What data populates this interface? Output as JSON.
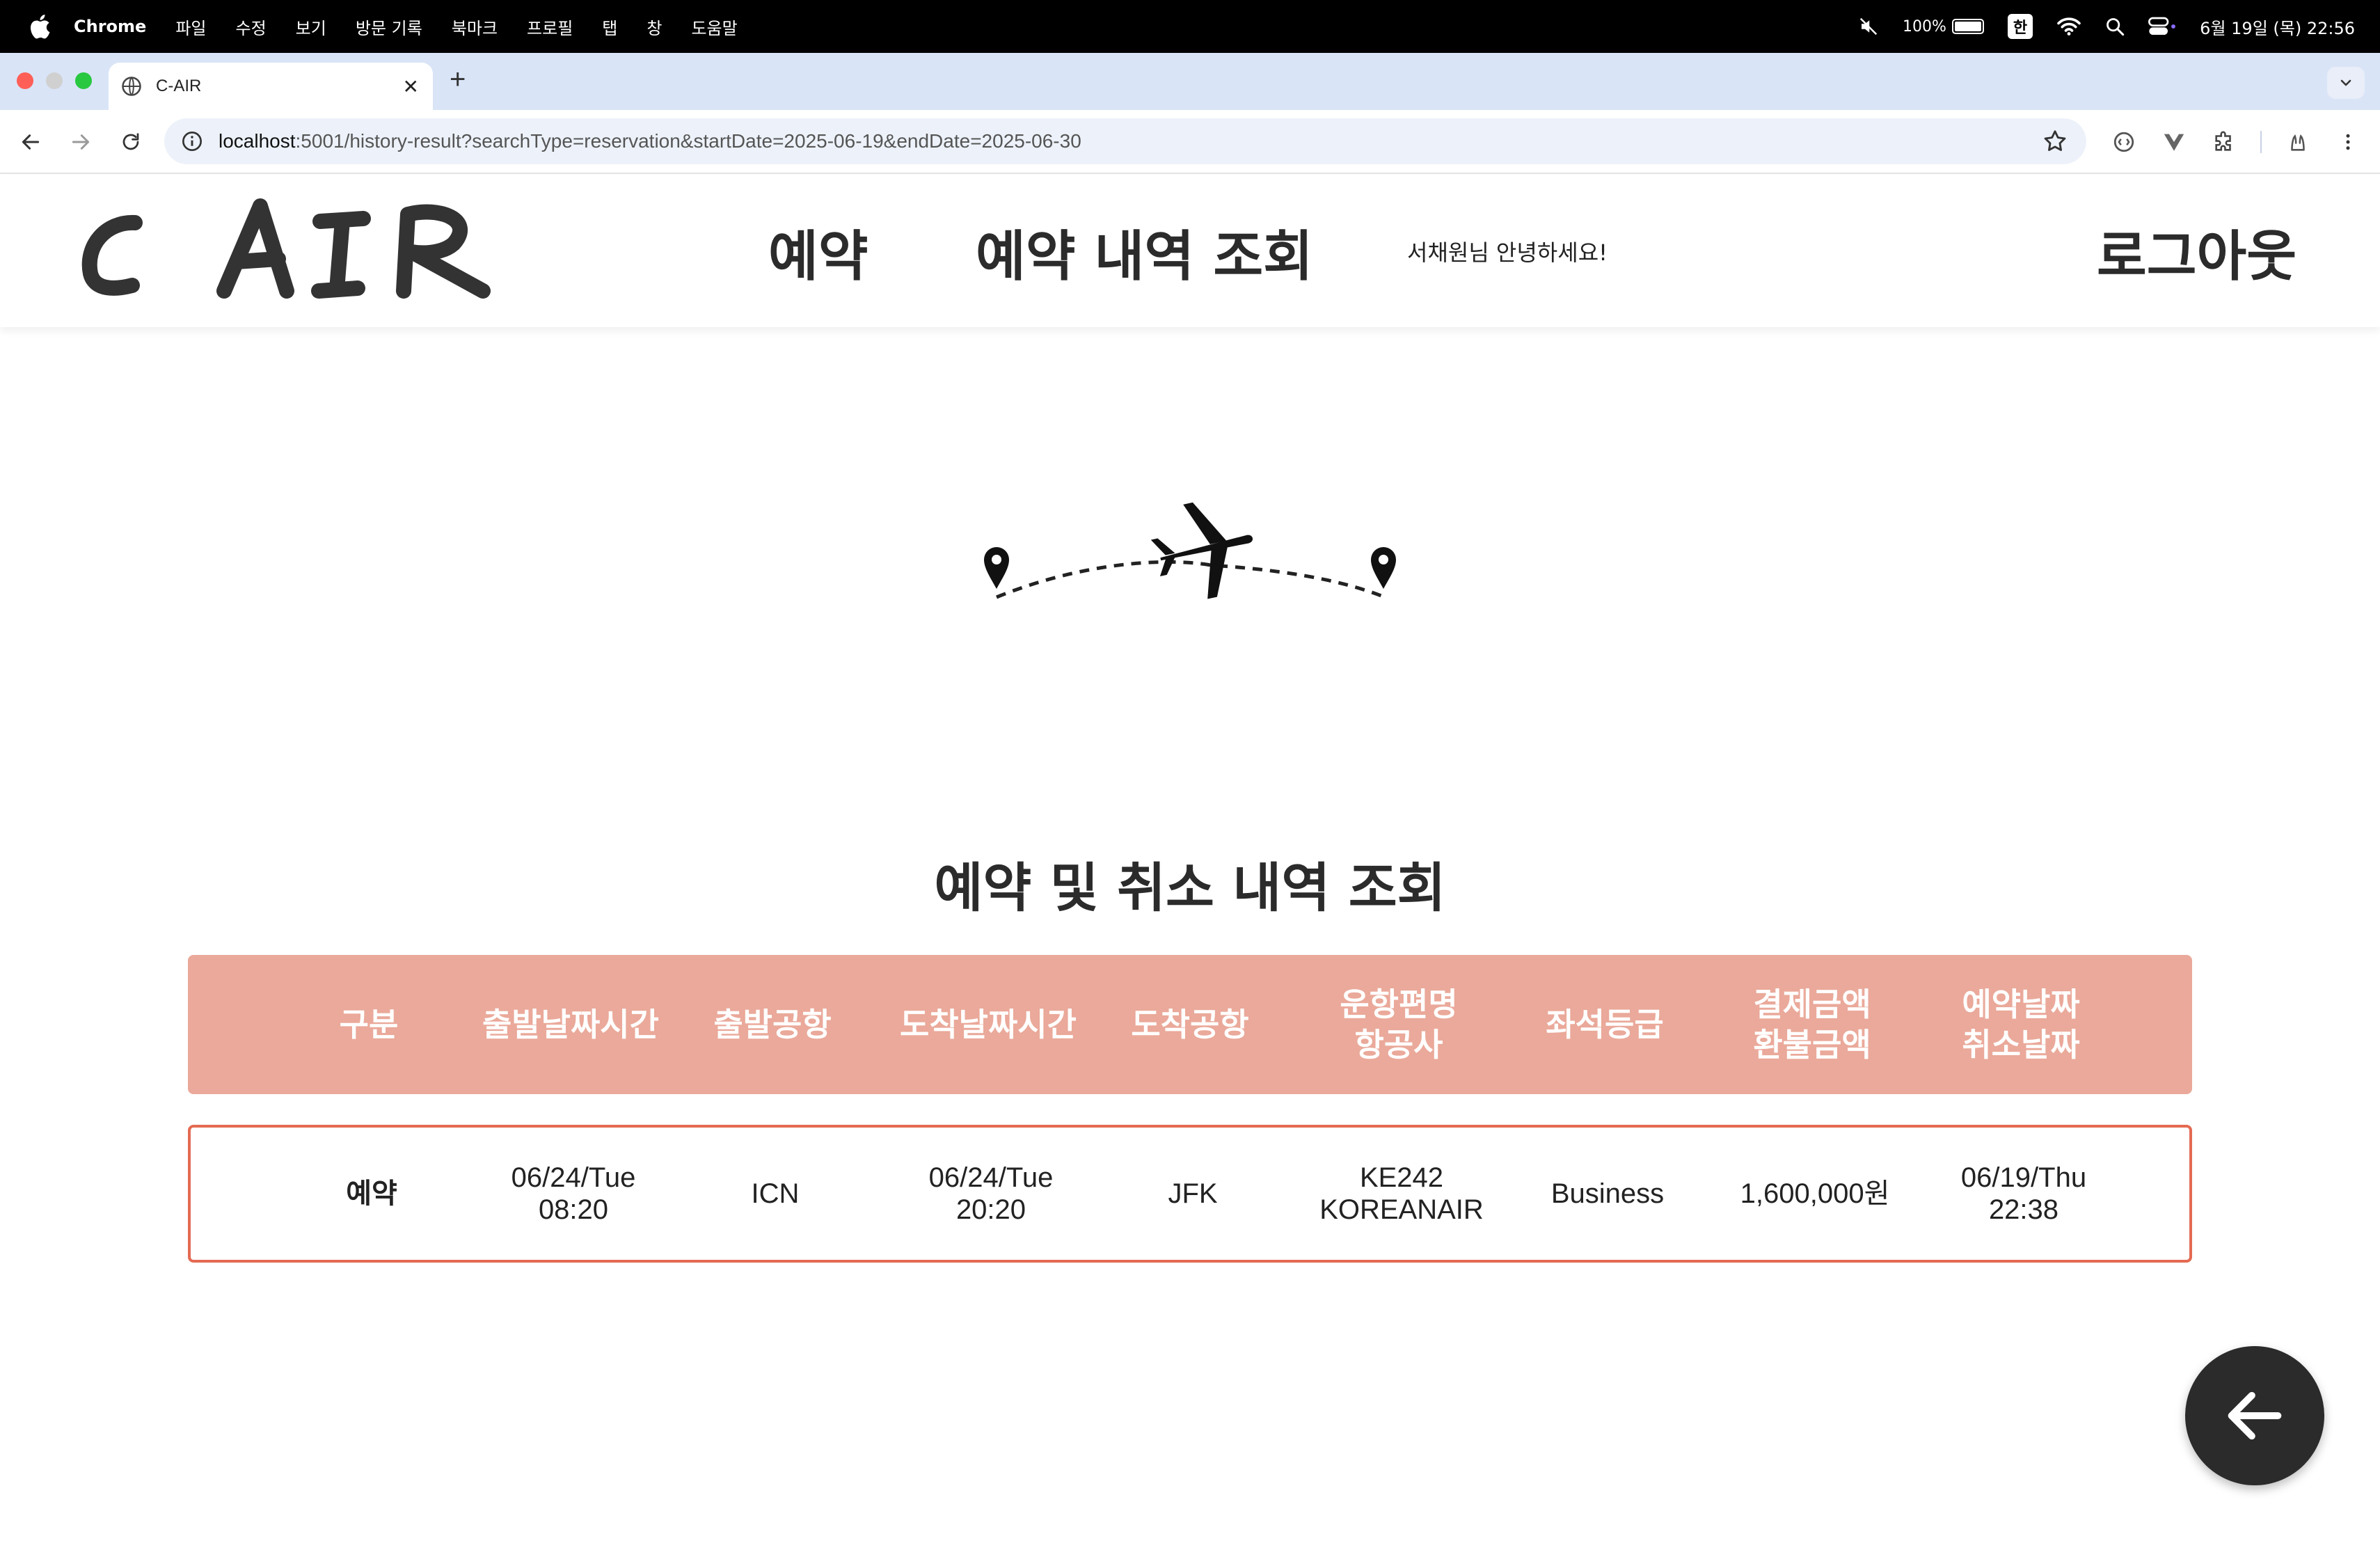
{
  "menubar": {
    "app_name": "Chrome",
    "items": [
      "파일",
      "수정",
      "보기",
      "방문 기록",
      "북마크",
      "프로필",
      "탭",
      "창",
      "도움말"
    ],
    "battery": "100%",
    "input_method": "한",
    "datetime": "6월 19일 (목) 22:56"
  },
  "browser": {
    "tab_title": "C-AIR",
    "url_host": "localhost",
    "url_rest": ":5001/history-result?searchType=reservation&startDate=2025-06-19&endDate=2025-06-30"
  },
  "site": {
    "logo_text": "C AIR",
    "nav": {
      "reserve": "예약",
      "history": "예약 내역 조회"
    },
    "greeting": "서채원님 안녕하세요!",
    "logout": "로그아웃"
  },
  "page": {
    "title": "예약 및 취소 내역 조회"
  },
  "table": {
    "headers": [
      {
        "line1": "구분",
        "line2": ""
      },
      {
        "line1": "출발날짜시간",
        "line2": ""
      },
      {
        "line1": "출발공항",
        "line2": ""
      },
      {
        "line1": "도착날짜시간",
        "line2": ""
      },
      {
        "line1": "도착공항",
        "line2": ""
      },
      {
        "line1": "운항편명",
        "line2": "항공사"
      },
      {
        "line1": "좌석등급",
        "line2": ""
      },
      {
        "line1": "결제금액",
        "line2": "환불금액"
      },
      {
        "line1": "예약날짜",
        "line2": "취소날짜"
      }
    ],
    "rows": [
      {
        "type": "예약",
        "departure_date": "06/24/Tue",
        "departure_time": "08:20",
        "departure_airport": "ICN",
        "arrival_date": "06/24/Tue",
        "arrival_time": "20:20",
        "arrival_airport": "JFK",
        "flight_no": "KE242",
        "airline": "KOREANAIR",
        "seat_class": "Business",
        "amount": "1,600,000원",
        "reserved_date": "06/19/Thu",
        "reserved_time": "22:38"
      }
    ]
  },
  "colors": {
    "header_bg": "#eaa99a",
    "row_border": "#e46a52",
    "fab_bg": "#2b2b2b"
  },
  "icons": [
    "apple-icon",
    "mute-icon",
    "wifi-icon",
    "search-icon",
    "control-center-icon",
    "globe-icon",
    "back-arrow-icon",
    "forward-arrow-icon",
    "reload-icon",
    "info-icon",
    "star-icon",
    "extension-icon",
    "menu-dots-icon",
    "airplane-icon",
    "location-pin-icon",
    "arrow-left-icon"
  ]
}
